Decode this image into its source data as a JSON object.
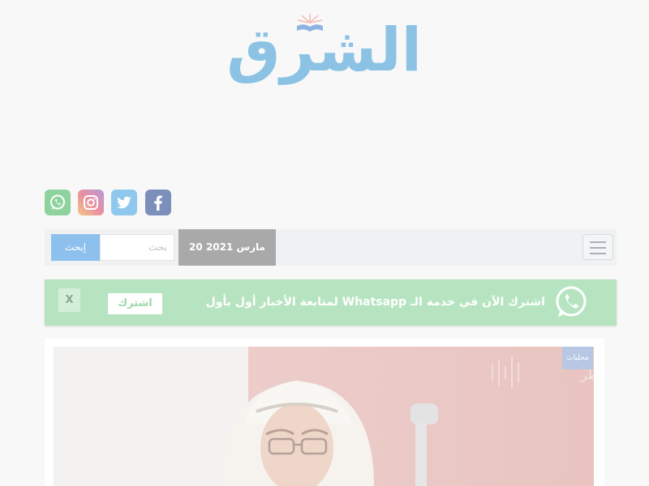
{
  "header": {
    "logo_text": "الشرق"
  },
  "social": {
    "items": [
      {
        "name": "facebook",
        "icon": "facebook-icon",
        "color": "#7c8fba"
      },
      {
        "name": "twitter",
        "icon": "twitter-icon",
        "color": "#8fc8ec"
      },
      {
        "name": "instagram",
        "icon": "instagram-icon",
        "color": "#e98fa0"
      },
      {
        "name": "whatsapp",
        "icon": "whatsapp-icon",
        "color": "#8ed39e"
      }
    ]
  },
  "nav": {
    "date": "20 مارس 2021",
    "search": {
      "placeholder": "بحث",
      "button_label": "إبحث"
    },
    "menu_icon": "hamburger-icon"
  },
  "whatsapp_banner": {
    "text": "اشترك الآن في خدمة الـ Whatsapp لمتابعة الأخبار أول بأول",
    "subscribe_label": "اشترك",
    "close_label": "X",
    "color": "#b7e4c0"
  },
  "article": {
    "category": "محليات",
    "watermark": "إذاعة قطر"
  }
}
